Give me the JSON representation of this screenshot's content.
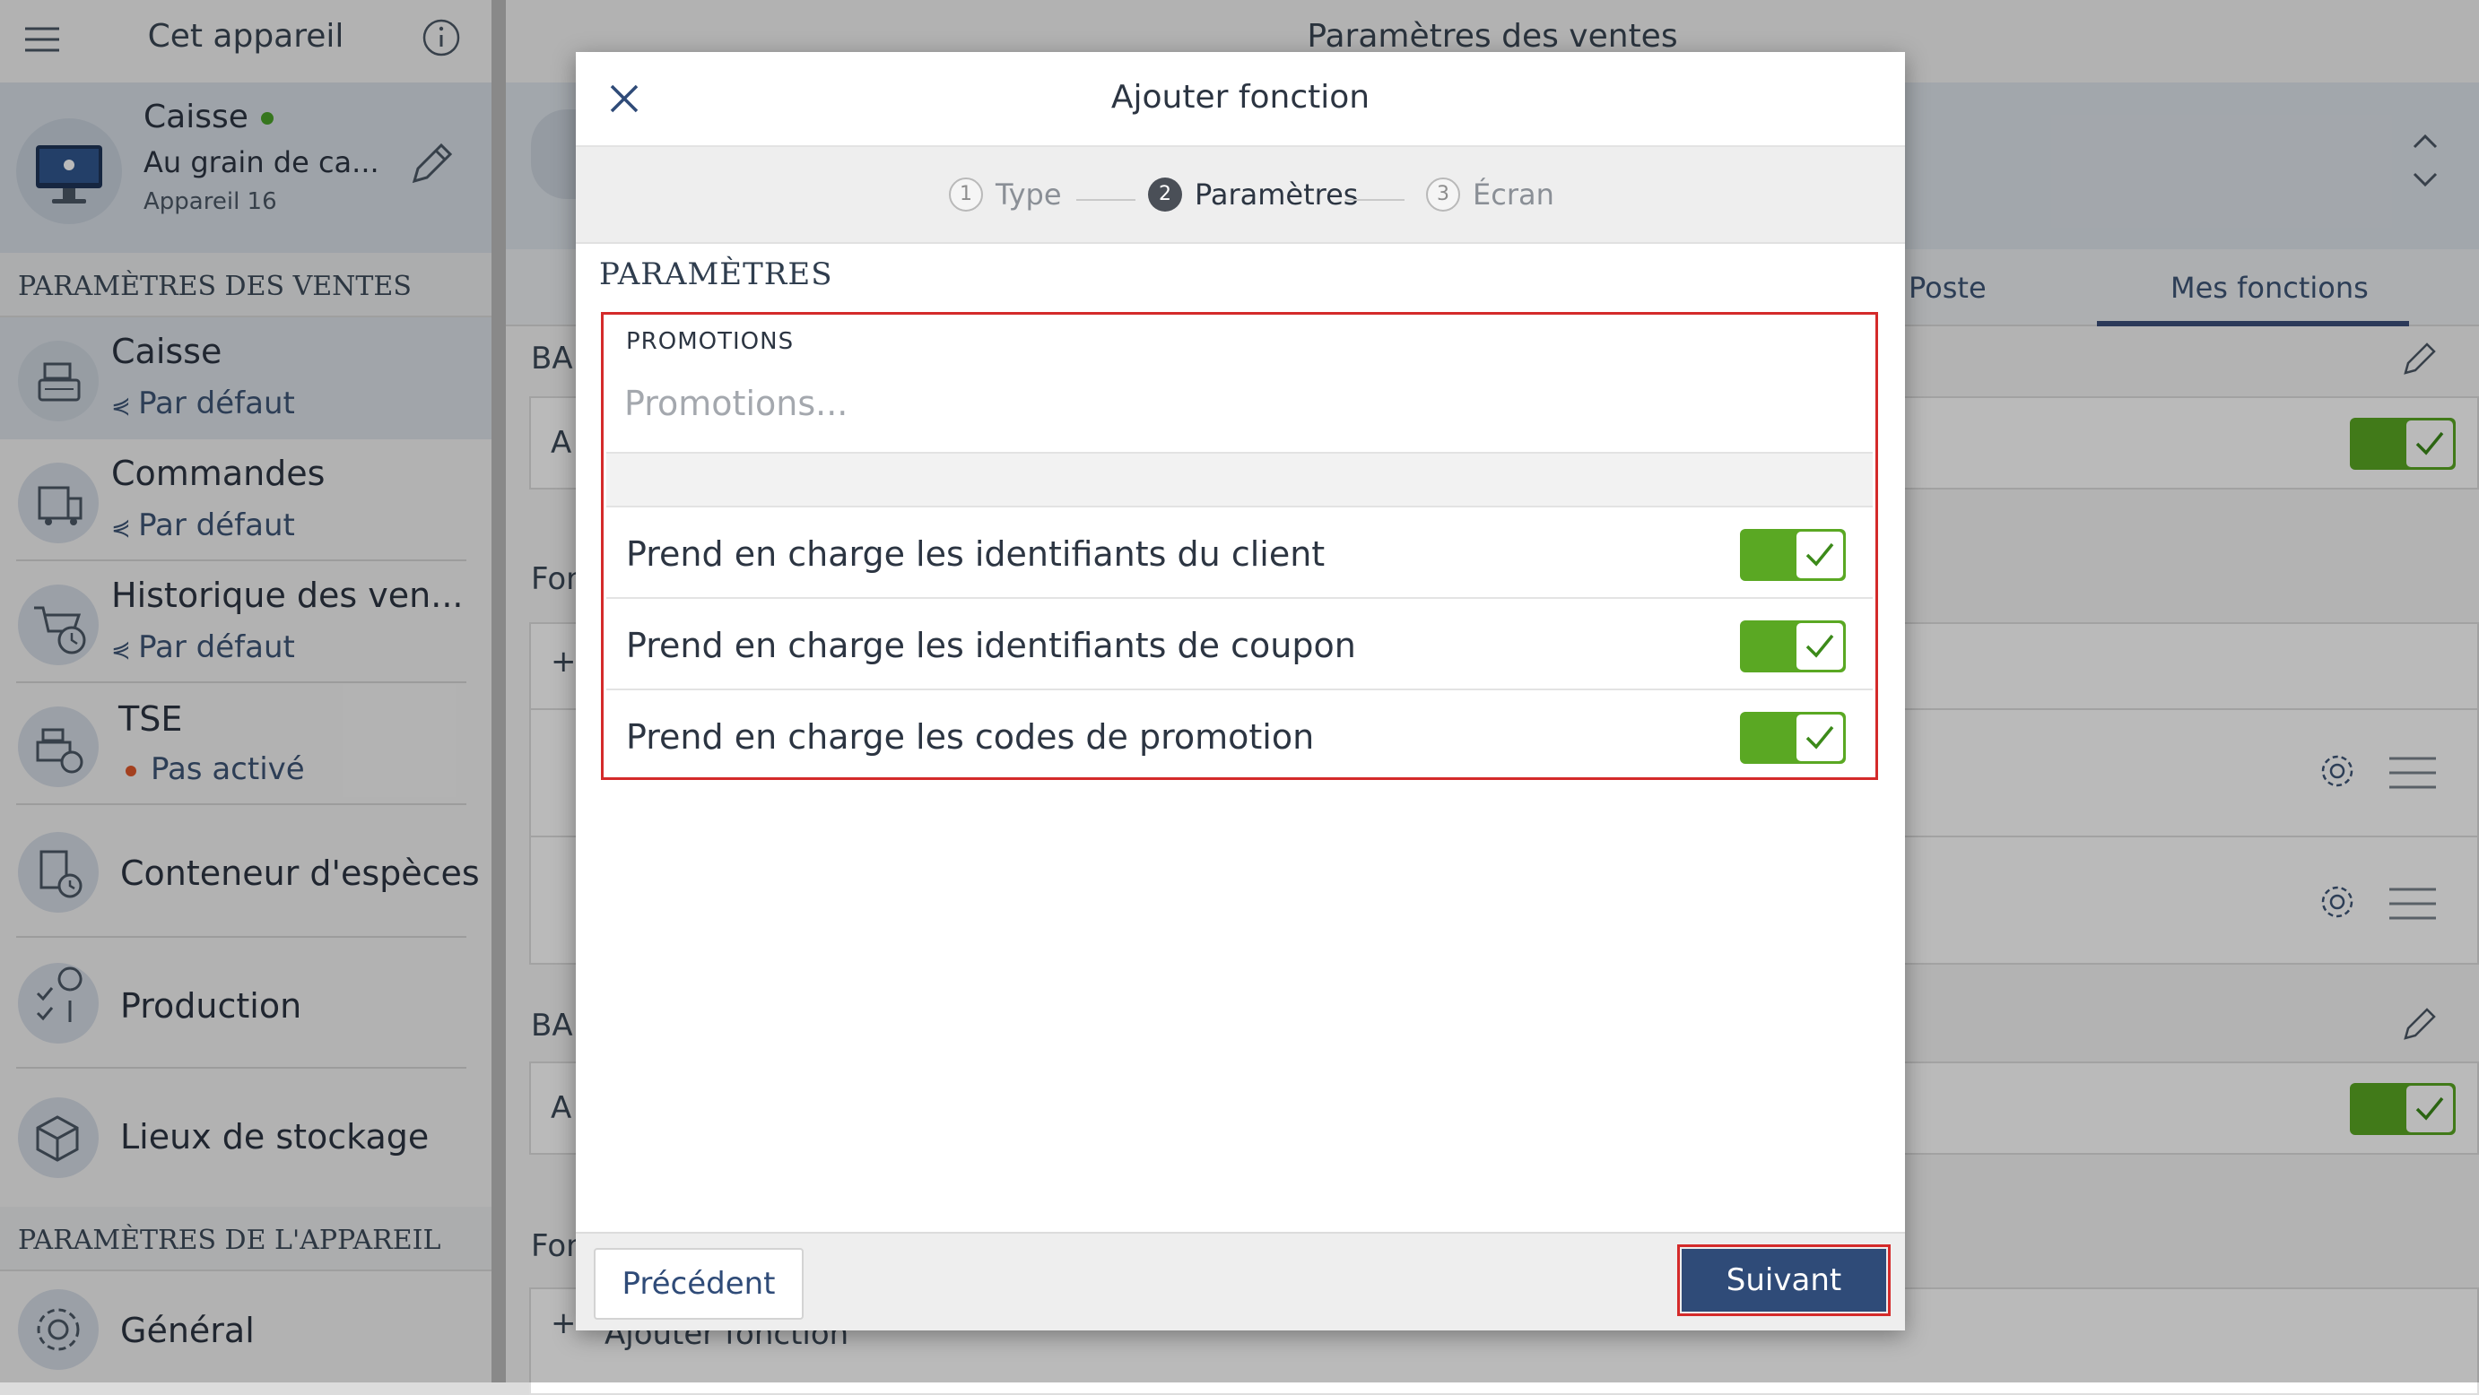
{
  "sidebar": {
    "title": "Cet appareil",
    "device": {
      "name": "Caisse",
      "subtitle": "Au grain de ca...",
      "number": "Appareil 16"
    },
    "sales_section_title": "PARAMÈTRES DES VENTES",
    "items": [
      {
        "label": "Caisse",
        "sub": "Par défaut"
      },
      {
        "label": "Commandes",
        "sub": "Par défaut"
      },
      {
        "label": "Historique des ven...",
        "sub": "Par défaut"
      },
      {
        "label": "TSE",
        "sub": "Pas activé"
      },
      {
        "label": "Conteneur d'espèces"
      },
      {
        "label": "Production"
      },
      {
        "label": "Lieux de stockage"
      }
    ],
    "device_section_title": "PARAMÈTRES DE L'APPAREIL",
    "general_label": "Général"
  },
  "main": {
    "title": "Paramètres des ventes",
    "tabs": [
      "Poste",
      "Mes fonctions"
    ],
    "bg_fragments": [
      "BA",
      "A",
      "Fon",
      "+",
      "BA",
      "A",
      "Fon",
      "+",
      "Ajouter fonction"
    ]
  },
  "modal": {
    "title": "Ajouter fonction",
    "steps": [
      {
        "num": "1",
        "label": "Type"
      },
      {
        "num": "2",
        "label": "Paramètres"
      },
      {
        "num": "3",
        "label": "Écran"
      }
    ],
    "section_title": "PARAMÈTRES",
    "field_label": "PROMOTIONS",
    "field_placeholder": "Promotions...",
    "field_value": "",
    "options": [
      {
        "label": "Prend en charge les identifiants du client",
        "enabled": true
      },
      {
        "label": "Prend en charge les identifiants de coupon",
        "enabled": true
      },
      {
        "label": "Prend en charge les codes de promotion",
        "enabled": true
      }
    ],
    "prev_label": "Précédent",
    "next_label": "Suivant"
  },
  "colors": {
    "accent": "#2f4b78",
    "toggle_on": "#5aa823",
    "highlight": "#d42a2a",
    "status_ok": "#4ba22a",
    "status_off": "#e0582b"
  }
}
